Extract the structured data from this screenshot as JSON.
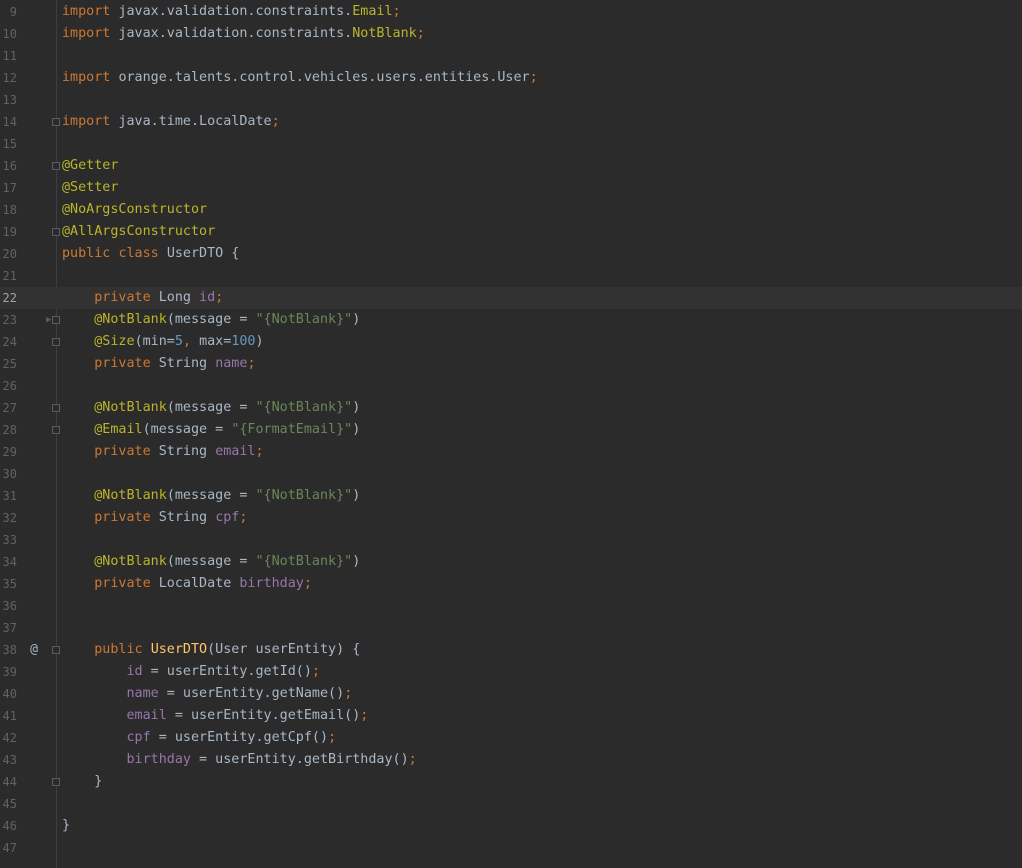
{
  "editor": {
    "language": "java",
    "current_line": "22",
    "colors": {
      "background": "#2b2b2b",
      "keyword": "#cc7832",
      "annotation": "#bbb529",
      "string": "#6a8759",
      "number": "#6897bb",
      "field": "#9876aa",
      "method_decl": "#ffc66d",
      "plain": "#a9b7c6",
      "line_number": "#606366"
    },
    "lines": [
      {
        "n": "9",
        "tokens": [
          {
            "t": "import ",
            "c": "kw"
          },
          {
            "t": "javax.validation.constraints.",
            "c": "pl"
          },
          {
            "t": "Email",
            "c": "ann"
          },
          {
            "t": ";",
            "c": "kw"
          }
        ]
      },
      {
        "n": "10",
        "tokens": [
          {
            "t": "import ",
            "c": "kw"
          },
          {
            "t": "javax.validation.constraints.",
            "c": "pl"
          },
          {
            "t": "NotBlank",
            "c": "ann"
          },
          {
            "t": ";",
            "c": "kw"
          }
        ]
      },
      {
        "n": "11",
        "tokens": []
      },
      {
        "n": "12",
        "tokens": [
          {
            "t": "import ",
            "c": "kw"
          },
          {
            "t": "orange.talents.control.vehicles.users.entities.User",
            "c": "pl"
          },
          {
            "t": ";",
            "c": "kw"
          }
        ]
      },
      {
        "n": "13",
        "tokens": []
      },
      {
        "n": "14",
        "fold": true,
        "tokens": [
          {
            "t": "import ",
            "c": "kw"
          },
          {
            "t": "java.time.LocalDate",
            "c": "pl"
          },
          {
            "t": ";",
            "c": "kw"
          }
        ]
      },
      {
        "n": "15",
        "tokens": []
      },
      {
        "n": "16",
        "fold": true,
        "tokens": [
          {
            "t": "@Getter",
            "c": "ann"
          }
        ]
      },
      {
        "n": "17",
        "tokens": [
          {
            "t": "@Setter",
            "c": "ann"
          }
        ]
      },
      {
        "n": "18",
        "tokens": [
          {
            "t": "@NoArgsConstructor",
            "c": "ann"
          }
        ]
      },
      {
        "n": "19",
        "fold": true,
        "tokens": [
          {
            "t": "@AllArgsConstructor",
            "c": "ann"
          }
        ]
      },
      {
        "n": "20",
        "tokens": [
          {
            "t": "public ",
            "c": "kw"
          },
          {
            "t": "class ",
            "c": "kw"
          },
          {
            "t": "UserDTO {",
            "c": "pl"
          }
        ]
      },
      {
        "n": "21",
        "tokens": []
      },
      {
        "n": "22",
        "tokens": [
          {
            "t": "    private ",
            "c": "kw"
          },
          {
            "t": "Long ",
            "c": "pl"
          },
          {
            "t": "id",
            "c": "fld"
          },
          {
            "t": ";",
            "c": "kw"
          }
        ]
      },
      {
        "n": "23",
        "fold": true,
        "arrow": true,
        "tokens": [
          {
            "t": "    @NotBlank",
            "c": "ann"
          },
          {
            "t": "(message = ",
            "c": "pl"
          },
          {
            "t": "\"{NotBlank}\"",
            "c": "str"
          },
          {
            "t": ")",
            "c": "pl"
          }
        ]
      },
      {
        "n": "24",
        "fold": true,
        "tokens": [
          {
            "t": "    @Size",
            "c": "ann"
          },
          {
            "t": "(min=",
            "c": "pl"
          },
          {
            "t": "5",
            "c": "num"
          },
          {
            "t": ", ",
            "c": "kw"
          },
          {
            "t": "max=",
            "c": "pl"
          },
          {
            "t": "100",
            "c": "num"
          },
          {
            "t": ")",
            "c": "pl"
          }
        ]
      },
      {
        "n": "25",
        "tokens": [
          {
            "t": "    private ",
            "c": "kw"
          },
          {
            "t": "String ",
            "c": "pl"
          },
          {
            "t": "name",
            "c": "fld"
          },
          {
            "t": ";",
            "c": "kw"
          }
        ]
      },
      {
        "n": "26",
        "tokens": []
      },
      {
        "n": "27",
        "fold": true,
        "tokens": [
          {
            "t": "    @NotBlank",
            "c": "ann"
          },
          {
            "t": "(message = ",
            "c": "pl"
          },
          {
            "t": "\"{NotBlank}\"",
            "c": "str"
          },
          {
            "t": ")",
            "c": "pl"
          }
        ]
      },
      {
        "n": "28",
        "fold": true,
        "tokens": [
          {
            "t": "    @Email",
            "c": "ann"
          },
          {
            "t": "(message = ",
            "c": "pl"
          },
          {
            "t": "\"{FormatEmail}\"",
            "c": "str"
          },
          {
            "t": ")",
            "c": "pl"
          }
        ]
      },
      {
        "n": "29",
        "tokens": [
          {
            "t": "    private ",
            "c": "kw"
          },
          {
            "t": "String ",
            "c": "pl"
          },
          {
            "t": "email",
            "c": "fld"
          },
          {
            "t": ";",
            "c": "kw"
          }
        ]
      },
      {
        "n": "30",
        "tokens": []
      },
      {
        "n": "31",
        "tokens": [
          {
            "t": "    @NotBlank",
            "c": "ann"
          },
          {
            "t": "(message = ",
            "c": "pl"
          },
          {
            "t": "\"{NotBlank}\"",
            "c": "str"
          },
          {
            "t": ")",
            "c": "pl"
          }
        ]
      },
      {
        "n": "32",
        "tokens": [
          {
            "t": "    private ",
            "c": "kw"
          },
          {
            "t": "String ",
            "c": "pl"
          },
          {
            "t": "cpf",
            "c": "fld"
          },
          {
            "t": ";",
            "c": "kw"
          }
        ]
      },
      {
        "n": "33",
        "tokens": []
      },
      {
        "n": "34",
        "tokens": [
          {
            "t": "    @NotBlank",
            "c": "ann"
          },
          {
            "t": "(message = ",
            "c": "pl"
          },
          {
            "t": "\"{NotBlank}\"",
            "c": "str"
          },
          {
            "t": ")",
            "c": "pl"
          }
        ]
      },
      {
        "n": "35",
        "tokens": [
          {
            "t": "    private ",
            "c": "kw"
          },
          {
            "t": "LocalDate ",
            "c": "pl"
          },
          {
            "t": "birthday",
            "c": "fld"
          },
          {
            "t": ";",
            "c": "kw"
          }
        ]
      },
      {
        "n": "36",
        "tokens": []
      },
      {
        "n": "37",
        "tokens": []
      },
      {
        "n": "38",
        "fold": true,
        "marker": "@",
        "tokens": [
          {
            "t": "    public ",
            "c": "kw"
          },
          {
            "t": "UserDTO",
            "c": "fn"
          },
          {
            "t": "(User userEntity) {",
            "c": "pl"
          }
        ]
      },
      {
        "n": "39",
        "tokens": [
          {
            "t": "        ",
            "c": "pl"
          },
          {
            "t": "id",
            "c": "fld"
          },
          {
            "t": " = userEntity.getId()",
            "c": "pl"
          },
          {
            "t": ";",
            "c": "kw"
          }
        ]
      },
      {
        "n": "40",
        "tokens": [
          {
            "t": "        ",
            "c": "pl"
          },
          {
            "t": "name",
            "c": "fld"
          },
          {
            "t": " = userEntity.getName()",
            "c": "pl"
          },
          {
            "t": ";",
            "c": "kw"
          }
        ]
      },
      {
        "n": "41",
        "tokens": [
          {
            "t": "        ",
            "c": "pl"
          },
          {
            "t": "email",
            "c": "fld"
          },
          {
            "t": " = userEntity.getEmail()",
            "c": "pl"
          },
          {
            "t": ";",
            "c": "kw"
          }
        ]
      },
      {
        "n": "42",
        "tokens": [
          {
            "t": "        ",
            "c": "pl"
          },
          {
            "t": "cpf",
            "c": "fld"
          },
          {
            "t": " = userEntity.getCpf()",
            "c": "pl"
          },
          {
            "t": ";",
            "c": "kw"
          }
        ]
      },
      {
        "n": "43",
        "tokens": [
          {
            "t": "        ",
            "c": "pl"
          },
          {
            "t": "birthday",
            "c": "fld"
          },
          {
            "t": " = userEntity.getBirthday()",
            "c": "pl"
          },
          {
            "t": ";",
            "c": "kw"
          }
        ]
      },
      {
        "n": "44",
        "fold": true,
        "tokens": [
          {
            "t": "    }",
            "c": "pl"
          }
        ]
      },
      {
        "n": "45",
        "tokens": []
      },
      {
        "n": "46",
        "tokens": [
          {
            "t": "}",
            "c": "pl"
          }
        ]
      },
      {
        "n": "47",
        "tokens": []
      }
    ]
  }
}
